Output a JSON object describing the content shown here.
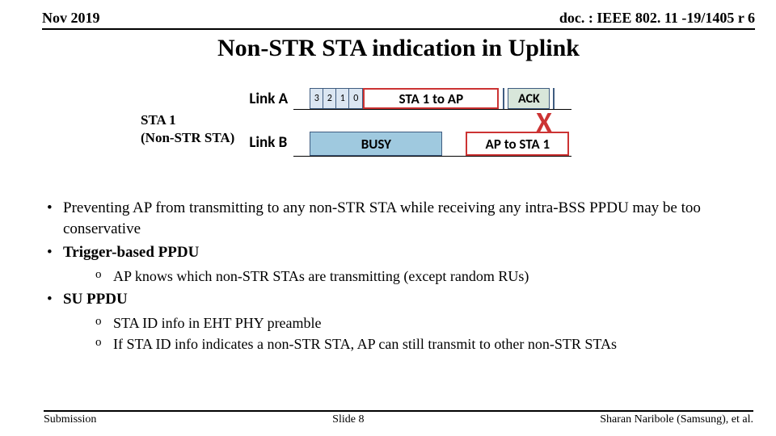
{
  "header": {
    "date": "Nov 2019",
    "doc": "doc. : IEEE 802. 11 -19/1405 r 6"
  },
  "title": "Non-STR STA indication in Uplink",
  "sta_label": {
    "line1": "STA 1",
    "line2": "(Non-STR STA)"
  },
  "diagram": {
    "linkA": "Link A",
    "linkB": "Link B",
    "preamble": [
      "3",
      "2",
      "1",
      "0"
    ],
    "sta1ap": "STA 1 to AP",
    "ack": "ACK",
    "busy": "BUSY",
    "aptosta": "AP to STA 1",
    "x": "X"
  },
  "bullets": {
    "b1": "Preventing AP from transmitting to any non-STR STA while receiving any intra-BSS PPDU may be too conservative",
    "b2": "Trigger-based PPDU",
    "b2s1": "AP knows which non-STR STAs are transmitting (except random RUs)",
    "b3": "SU PPDU",
    "b3s1": "STA ID info in EHT PHY preamble",
    "b3s2": "If STA ID info indicates a non-STR STA,  AP can still transmit to other non-STR STAs"
  },
  "footer": {
    "left": "Submission",
    "center": "Slide 8",
    "right": "Sharan Naribole (Samsung), et al."
  }
}
